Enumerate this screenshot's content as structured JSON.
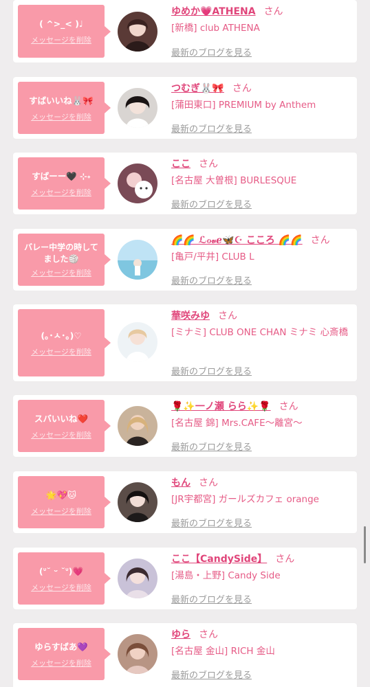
{
  "common": {
    "delete_label": "メッセージを削除",
    "blog_label": "最新のブログを見る",
    "san_label": "さん"
  },
  "entries": [
    {
      "message": "( ^>_< )♩",
      "name": "ゆめか💗ATHENA",
      "shop": "[新橋] club ATHENA"
    },
    {
      "message": "すばいいね🐰🎀",
      "name": "つむぎ🐰🎀",
      "shop": "[蒲田東口] PREMIUM by Anthem"
    },
    {
      "message": "すばーー🖤 ⊹˖",
      "name": "ここ",
      "shop": "[名古屋 大曽根] BURLESQUE"
    },
    {
      "message": "バレー中学の時してました🏐",
      "name": "🌈🌈 ℒℴ𝓋ℯ🦋☪︎ こころ 🌈🌈",
      "shop": "[亀戸/平井] CLUB L"
    },
    {
      "message": "(｡･ㅅ･｡)♡",
      "name": "華咲みゆ",
      "shop": "[ミナミ] CLUB ONE CHAN ミナミ 心斎橋"
    },
    {
      "message": "スバいいね❤️",
      "name": "🌹✨一ノ瀬 らら✨🌹",
      "shop": "[名古屋 錦] Mrs.CAFE〜離宮〜"
    },
    {
      "message": "🌟💖🐱",
      "name": "もん",
      "shop": "[JR宇都宮] ガールズカフェ orange"
    },
    {
      "message": "(ᐡ˘ ᵕ ˘ᐡ)💗",
      "name": "ここ【CandySide】",
      "shop": "[湯島・上野] Candy Side"
    },
    {
      "message": "ゆらすばあ💜",
      "name": "ゆら",
      "shop": "[名古屋 金山] RICH 金山"
    }
  ]
}
